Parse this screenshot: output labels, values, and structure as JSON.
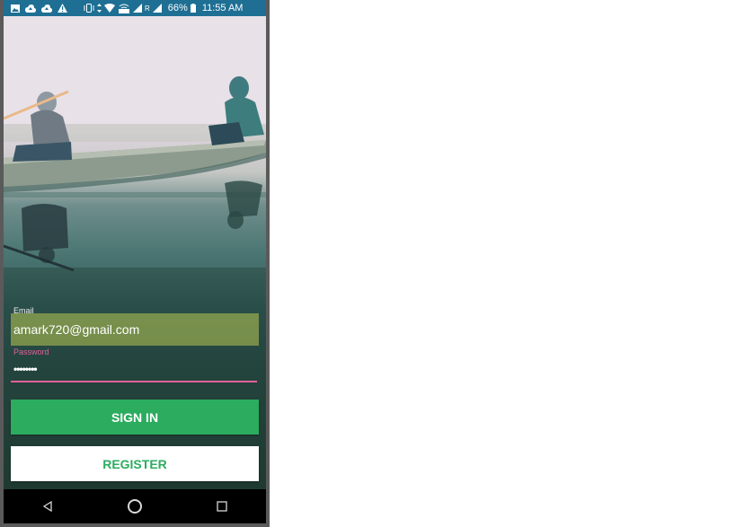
{
  "status_bar": {
    "battery": "66%",
    "time": "11:55 AM",
    "carrier_flag": "R",
    "left_icons": [
      "image-icon",
      "cloud-upload-icon",
      "cloud-upload-icon",
      "warning-icon"
    ],
    "right_icons": [
      "vibrate-icon",
      "data-transfer-icon",
      "wifi-icon",
      "volte-icon",
      "signal-icon",
      "signal-icon",
      "battery-icon"
    ],
    "color": "#1e6f93"
  },
  "login_form": {
    "email_label": "Email",
    "email_value": "amark720@gmail.com",
    "password_label": "Password",
    "password_value": "••••••••",
    "sign_in_label": "SIGN IN",
    "register_label": "REGISTER"
  },
  "colors": {
    "accent_green": "#2bac5f",
    "password_focus": "#e0609a",
    "email_highlight": "#aab950"
  },
  "nav_bar": {
    "icons": [
      "back-icon",
      "home-icon",
      "recents-icon"
    ]
  }
}
